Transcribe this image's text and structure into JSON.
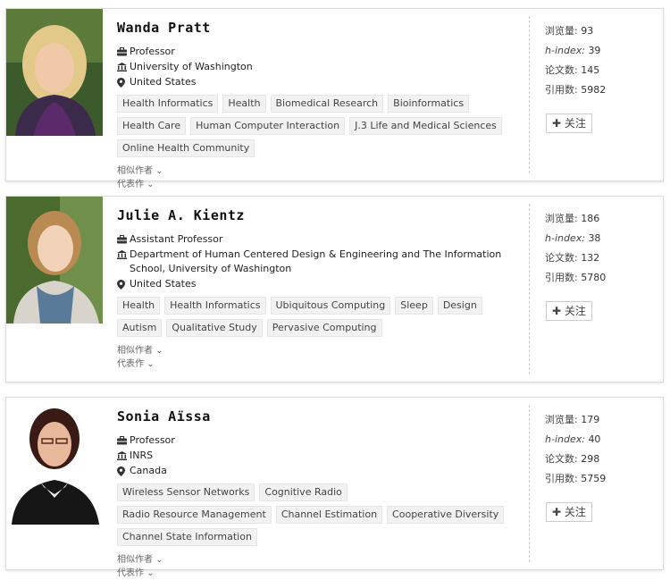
{
  "profiles": [
    {
      "name": "Wanda Pratt",
      "title": "Professor",
      "org": "University of Washington",
      "country": "United States",
      "tags": [
        "Health Informatics",
        "Health",
        "Biomedical Research",
        "Bioinformatics",
        "Health Care",
        "Human Computer Interaction",
        "J.3 Life and Medical Sciences",
        "Online Health Community"
      ],
      "similar_label": "相似作者 ⌄",
      "works_label": "代表作 ⌄",
      "stats": {
        "views_label": "浏览量:",
        "views": "93",
        "hindex_label": "h-index:",
        "hindex": "39",
        "papers_label": "论文数:",
        "papers": "145",
        "cites_label": "引用数:",
        "cites": "5982"
      },
      "follow_label": "✚ 关注"
    },
    {
      "name": "Julie A. Kientz",
      "title": "Assistant Professor",
      "org": "Department of Human Centered Design & Engineering and The Information School, University of Washington",
      "country": "United States",
      "tags": [
        "Health",
        "Health Informatics",
        "Ubiquitous Computing",
        "Sleep",
        "Design",
        "Autism",
        "Qualitative Study",
        "Pervasive Computing"
      ],
      "similar_label": "相似作者 ⌄",
      "works_label": "代表作 ⌄",
      "stats": {
        "views_label": "浏览量:",
        "views": "186",
        "hindex_label": "h-index:",
        "hindex": "38",
        "papers_label": "论文数:",
        "papers": "132",
        "cites_label": "引用数:",
        "cites": "5780"
      },
      "follow_label": "✚ 关注"
    },
    {
      "name": "Sonia Aïssa",
      "title": "Professor",
      "org": "INRS",
      "country": "Canada",
      "tags": [
        "Wireless Sensor Networks",
        "Cognitive Radio",
        "Radio Resource Management",
        "Channel Estimation",
        "Cooperative Diversity",
        "Channel State Information"
      ],
      "similar_label": "相似作者 ⌄",
      "works_label": "代表作 ⌄",
      "stats": {
        "views_label": "浏览量:",
        "views": "179",
        "hindex_label": "h-index:",
        "hindex": "40",
        "papers_label": "论文数:",
        "papers": "298",
        "cites_label": "引用数:",
        "cites": "5759"
      },
      "follow_label": "✚ 关注"
    }
  ],
  "icons": {
    "title": "briefcase-icon",
    "org": "institution-icon",
    "country": "map-pin-icon",
    "follow": "plus-icon"
  }
}
